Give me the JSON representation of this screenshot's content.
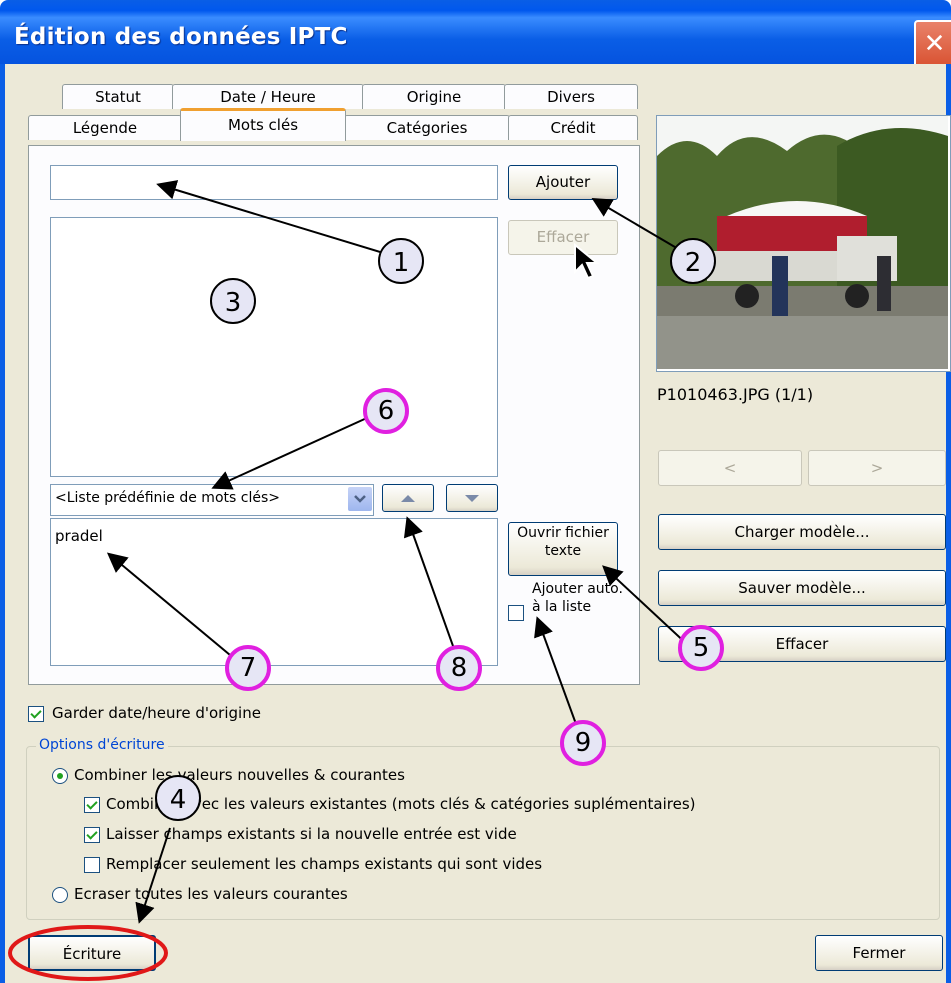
{
  "window": {
    "title": "Édition des données IPTC",
    "close_label": "✕"
  },
  "tabs_row1": [
    "Statut",
    "Date / Heure",
    "Origine",
    "Divers"
  ],
  "tabs_row2": [
    "Légende",
    "Mots clés",
    "Catégories",
    "Crédit"
  ],
  "keywords": {
    "input_value": "",
    "add_button": "Ajouter",
    "clear_button": "Effacer",
    "predefined_select": "<Liste prédéfinie de mots clés>",
    "list_text": "pradel",
    "open_text_button": "Ouvrir fichier texte",
    "auto_add_label": "Ajouter auto. à la liste"
  },
  "preview": {
    "filename": "P1010463.JPG (1/1)",
    "prev": "<",
    "next": ">",
    "load_template": "Charger modèle...",
    "save_template": "Sauver modèle...",
    "clear": "Effacer"
  },
  "keep_date": "Garder date/heure d'origine",
  "write_options": {
    "title": "Options d'écriture",
    "combine": "Combiner les valeurs nouvelles & courantes",
    "combine_existing": "Combiner avec les valeurs existantes (mots clés & catégories suplémentaires)",
    "keep_if_empty": "Laisser champs existants si la nouvelle entrée est vide",
    "replace_empty_only": "Remplacer seulement les champs existants qui sont vides",
    "overwrite": "Ecraser toutes les valeurs courantes"
  },
  "footer": {
    "write_button": "Écriture",
    "close_button": "Fermer"
  },
  "callouts": [
    "1",
    "2",
    "3",
    "4",
    "5",
    "6",
    "7",
    "8",
    "9"
  ]
}
